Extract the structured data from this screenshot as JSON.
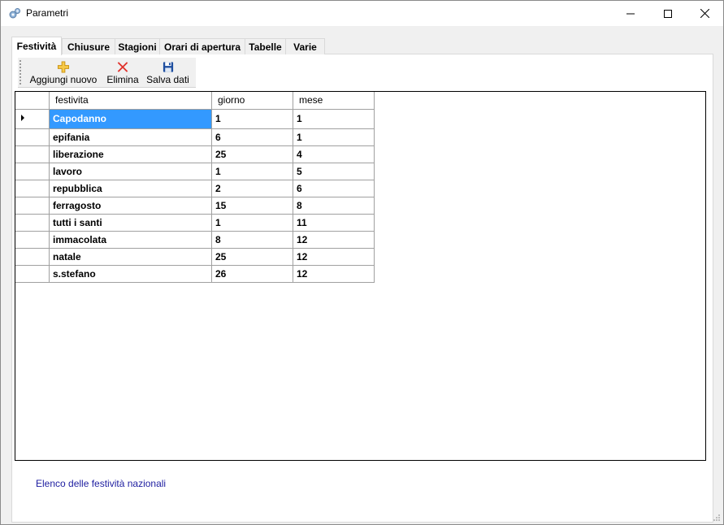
{
  "window": {
    "title": "Parametri"
  },
  "tabs": [
    {
      "label": "Festività",
      "active": true
    },
    {
      "label": "Chiusure",
      "active": false
    },
    {
      "label": "Stagioni",
      "active": false
    },
    {
      "label": "Orari di apertura",
      "active": false
    },
    {
      "label": "Tabelle",
      "active": false
    },
    {
      "label": "Varie",
      "active": false
    }
  ],
  "toolbar": {
    "add_label": "Aggiungi nuovo",
    "delete_label": "Elimina",
    "save_label": "Salva dati",
    "add_icon": "plus-icon",
    "delete_icon": "x-icon",
    "save_icon": "floppy-disk-icon"
  },
  "grid": {
    "columns": [
      "festivita",
      "giorno",
      "mese"
    ],
    "rows": [
      [
        "Capodanno",
        "1",
        "1"
      ],
      [
        "epifania",
        "6",
        "1"
      ],
      [
        "liberazione",
        "25",
        "4"
      ],
      [
        "lavoro",
        "1",
        "5"
      ],
      [
        "repubblica",
        "2",
        "6"
      ],
      [
        "ferragosto",
        "15",
        "8"
      ],
      [
        "tutti i santi",
        "1",
        "11"
      ],
      [
        "immacolata",
        "8",
        "12"
      ],
      [
        "natale",
        "25",
        "12"
      ],
      [
        "s.stefano",
        "26",
        "12"
      ]
    ],
    "current_row": 0
  },
  "caption": "Elenco delle festività nazionali",
  "colors": {
    "selection": "#3399ff",
    "caption": "#1d1da0"
  }
}
